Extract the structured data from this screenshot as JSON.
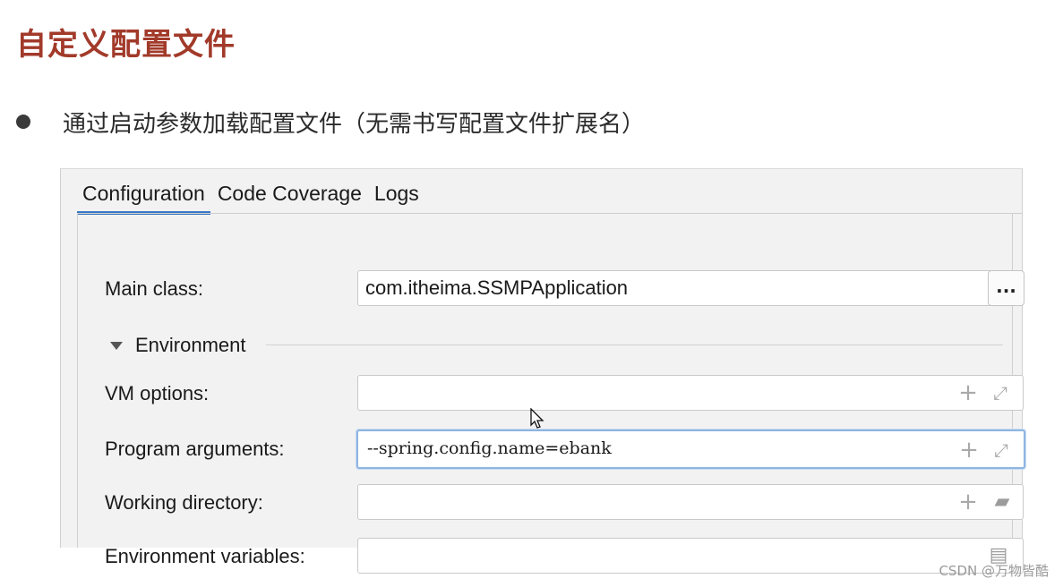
{
  "slide": {
    "title": "自定义配置文件",
    "bullet": "通过启动参数加载配置文件（无需书写配置文件扩展名）"
  },
  "tabs": [
    {
      "label": "Configuration",
      "active": true
    },
    {
      "label": "Code Coverage",
      "active": false
    },
    {
      "label": "Logs",
      "active": false
    }
  ],
  "form": {
    "main_class": {
      "label": "Main class:",
      "value": "com.itheima.SSMPApplication",
      "browse_label": "..."
    },
    "environment": {
      "title": "Environment"
    },
    "vm_options": {
      "label": "VM options:",
      "value": ""
    },
    "program_arguments": {
      "label": "Program arguments:",
      "value": "--spring.config.name=ebank"
    },
    "working_directory": {
      "label": "Working directory:",
      "value": ""
    },
    "environment_variables": {
      "label": "Environment variables:",
      "value": ""
    }
  },
  "icons": {
    "add": "plus-icon",
    "expand": "expand-icon",
    "folder": "folder-icon",
    "document": "document-icon",
    "collapse": "triangle-down-icon"
  },
  "colors": {
    "title": "#a23a2a",
    "active_tab_underline": "#3a78c3",
    "focus_border": "#8fb5e2"
  },
  "watermark": "CSDN @万物皆酷"
}
